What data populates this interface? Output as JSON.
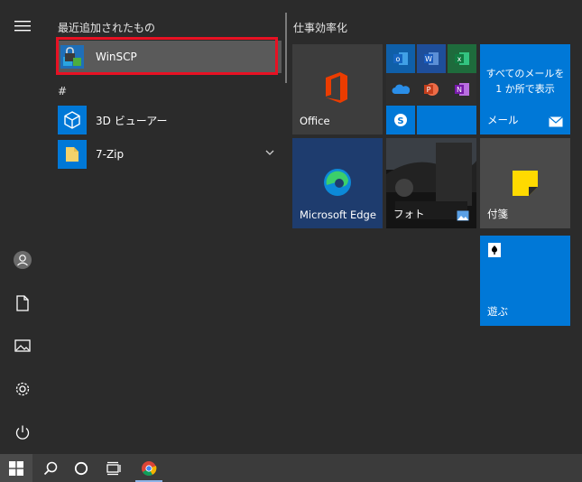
{
  "recent_header": "最近追加されたもの",
  "hash_header": "#",
  "apps": [
    {
      "label": "WinSCP",
      "icon": "winscp-icon"
    },
    {
      "label": "3D ビューアー",
      "icon": "3d-viewer-icon"
    },
    {
      "label": "7-Zip",
      "icon": "folder-icon"
    }
  ],
  "tiles_header": "仕事効率化",
  "tiles": {
    "office": "Office",
    "mail_text": "すべてのメールを 1 か所で表示",
    "mail_label": "メール",
    "edge": "Microsoft Edge",
    "photos": "フォト",
    "sticky": "付箋",
    "play": "遊ぶ"
  },
  "colors": {
    "accent": "#0078d7",
    "highlight": "#e81123",
    "background": "#2b2b2b"
  }
}
